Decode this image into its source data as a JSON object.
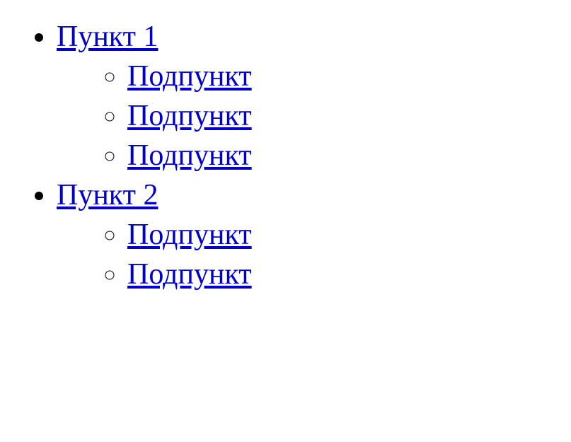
{
  "list": {
    "items": [
      {
        "label": "Пункт 1",
        "subitems": [
          {
            "label": "Подпункт"
          },
          {
            "label": "Подпункт"
          },
          {
            "label": "Подпункт"
          }
        ]
      },
      {
        "label": "Пункт 2",
        "subitems": [
          {
            "label": "Подпункт"
          },
          {
            "label": "Подпункт"
          }
        ]
      }
    ]
  }
}
